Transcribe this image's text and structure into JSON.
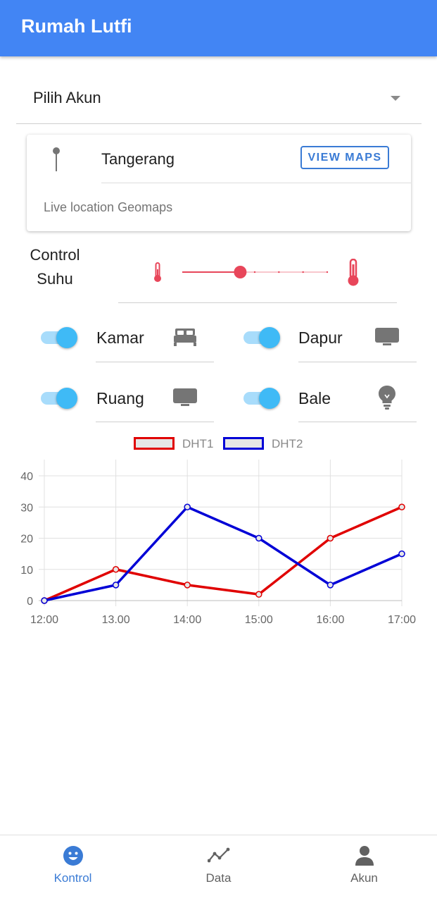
{
  "appbar": {
    "title": "Rumah Lutfi",
    "color": "#4285f4"
  },
  "account_select": {
    "label": "Pilih Akun"
  },
  "location_card": {
    "city": "Tangerang",
    "button_label": "VIEW MAPS",
    "subtitle": "Live location Geomaps",
    "icon": "pin-icon"
  },
  "temperature_control": {
    "label_line1": "Control",
    "label_line2": "Suhu",
    "slider_value_fraction": 0.4,
    "slider_steps": 6,
    "accent_color": "#e8465a"
  },
  "rooms": [
    {
      "label": "Kamar",
      "on": true,
      "icon": "bed-icon"
    },
    {
      "label": "Dapur",
      "on": true,
      "icon": "tv-icon"
    },
    {
      "label": "Ruang",
      "on": true,
      "icon": "tv-icon"
    },
    {
      "label": "Bale",
      "on": true,
      "icon": "lightbulb-icon"
    }
  ],
  "chart_data": {
    "type": "line",
    "categories": [
      "12:00",
      "13.00",
      "14:00",
      "15:00",
      "16:00",
      "17:00"
    ],
    "series": [
      {
        "name": "DHT1",
        "color": "#e00000",
        "values": [
          0,
          10,
          5,
          2,
          20,
          30
        ]
      },
      {
        "name": "DHT2",
        "color": "#0000d6",
        "values": [
          0,
          5,
          30,
          20,
          5,
          15
        ]
      }
    ],
    "ylim": [
      0,
      40
    ],
    "yticks": [
      0,
      10,
      20,
      30,
      40
    ],
    "grid": true,
    "legend_placement": "top-center"
  },
  "bottom_nav": [
    {
      "label": "Kontrol",
      "icon": "smiley-icon",
      "active": true
    },
    {
      "label": "Data",
      "icon": "trend-icon",
      "active": false
    },
    {
      "label": "Akun",
      "icon": "person-icon",
      "active": false
    }
  ]
}
